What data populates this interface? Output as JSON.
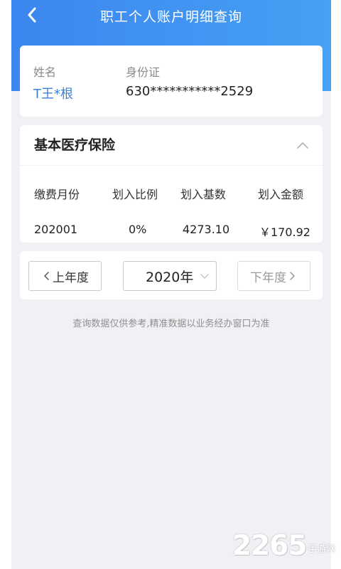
{
  "topbar": {
    "title": "职工个人账户明细查询",
    "back_icon": "chevron-left-icon"
  },
  "user": {
    "name_label": "姓名",
    "name_value": "T王*根",
    "id_label": "身份证",
    "id_value": "630***********2529"
  },
  "insurance": {
    "title": "基本医疗保险",
    "collapse_icon": "chevron-up-icon",
    "columns": [
      "缴费月份",
      "划入比例",
      "划入基数",
      "划入金额"
    ],
    "rows": [
      [
        "202001",
        "0%",
        "4273.10",
        "￥170.92"
      ]
    ]
  },
  "year_nav": {
    "prev_label": "上年度",
    "year_value": "2020年",
    "next_label": "下年度"
  },
  "note": "查询数据仅供参考,精准数据以业务经办窗口为准",
  "watermark": {
    "number": "2265",
    "suffix": "手游网"
  },
  "colors": {
    "header_start": "#3c86ef",
    "header_end": "#46a0f4",
    "name_link": "#3b83d6",
    "background": "#f0f1f5"
  }
}
